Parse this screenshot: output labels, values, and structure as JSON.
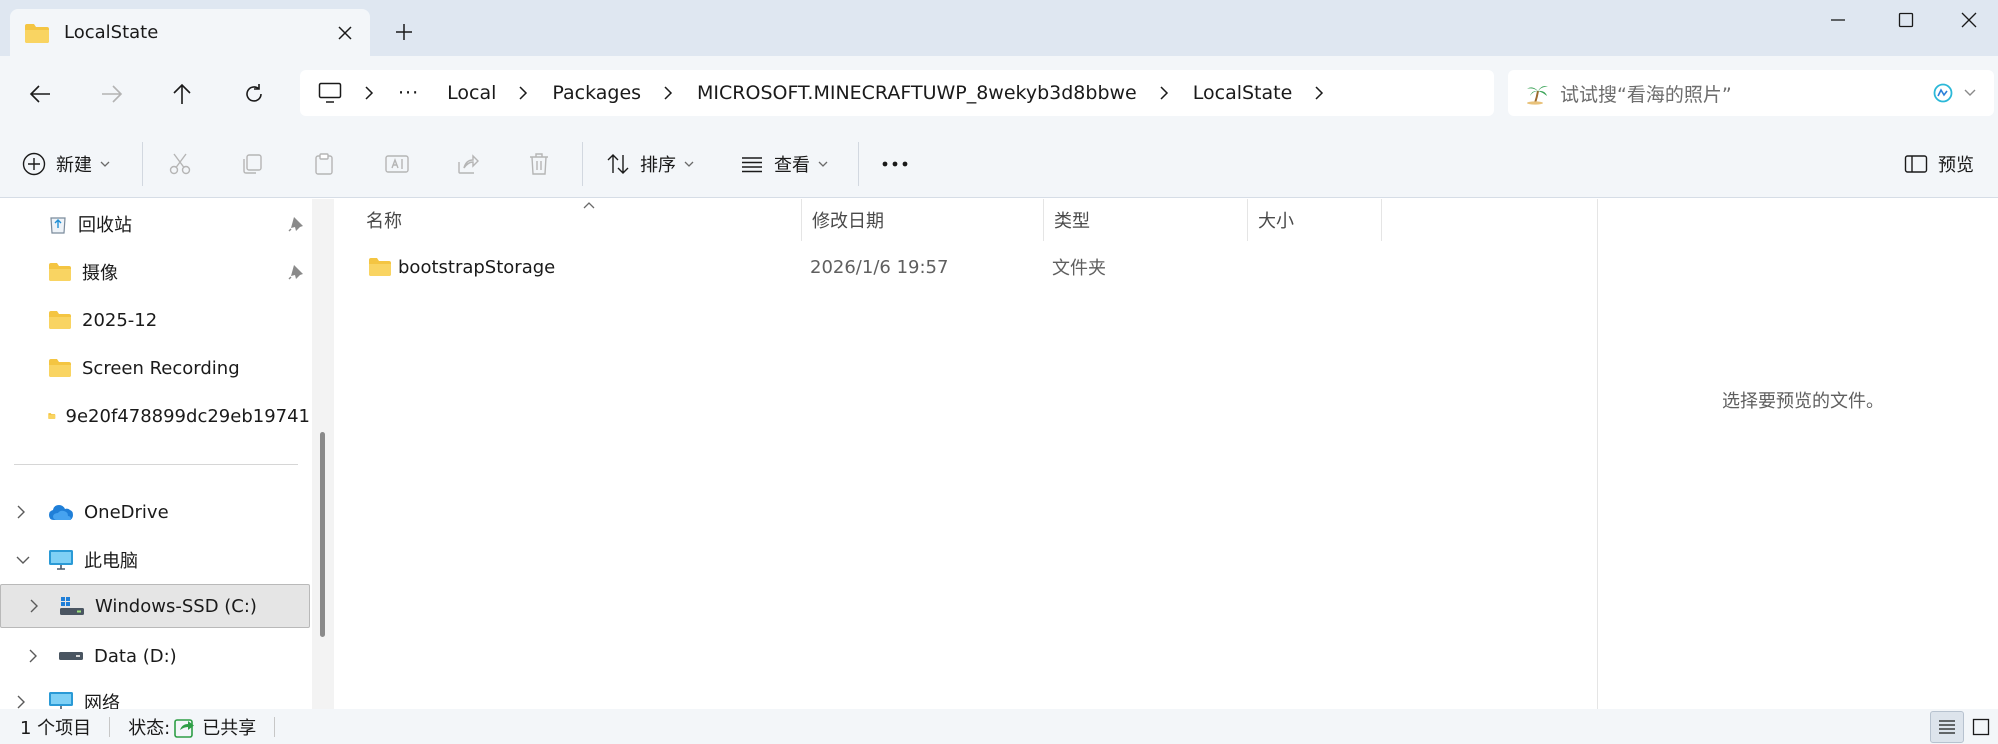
{
  "window": {
    "tab_title": "LocalState"
  },
  "address": {
    "crumbs": [
      "Local",
      "Packages",
      "MICROSOFT.MINECRAFTUWP_8wekyb3d8bbwe",
      "LocalState"
    ]
  },
  "search": {
    "placeholder": "试试搜“看海的照片”"
  },
  "toolbar": {
    "new_label": "新建",
    "sort_label": "排序",
    "view_label": "查看",
    "preview_label": "预览"
  },
  "sidebar": {
    "items": [
      {
        "label": "回收站",
        "icon": "recycle-bin-icon"
      },
      {
        "label": "摄像",
        "icon": "folder-icon"
      },
      {
        "label": "2025-12",
        "icon": "folder-icon"
      },
      {
        "label": "Screen Recording",
        "icon": "folder-icon"
      },
      {
        "label": "9e20f478899dc29eb19741",
        "icon": "folder-icon"
      },
      {
        "label": "OneDrive",
        "icon": "cloud-icon"
      },
      {
        "label": "此电脑",
        "icon": "computer-icon"
      },
      {
        "label": "Windows-SSD (C:)",
        "icon": "drive-icon"
      },
      {
        "label": "Data (D:)",
        "icon": "drive-icon"
      },
      {
        "label": "网络",
        "icon": "network-icon"
      }
    ]
  },
  "filelist": {
    "columns": [
      "名称",
      "修改日期",
      "类型",
      "大小"
    ],
    "rows": [
      {
        "name": "bootstrapStorage",
        "modified": "2026/1/6 19:57",
        "type": "文件夹",
        "size": ""
      }
    ]
  },
  "preview": {
    "message": "选择要预览的文件。"
  },
  "status": {
    "item_count": "1 个项目",
    "state_label": "状态:",
    "shared_label": "已共享"
  },
  "colors": {
    "chrome": "#f3f6f9",
    "titlebar": "#dfe7f1",
    "folder": "#f4c542",
    "accent": "#0067c0"
  }
}
